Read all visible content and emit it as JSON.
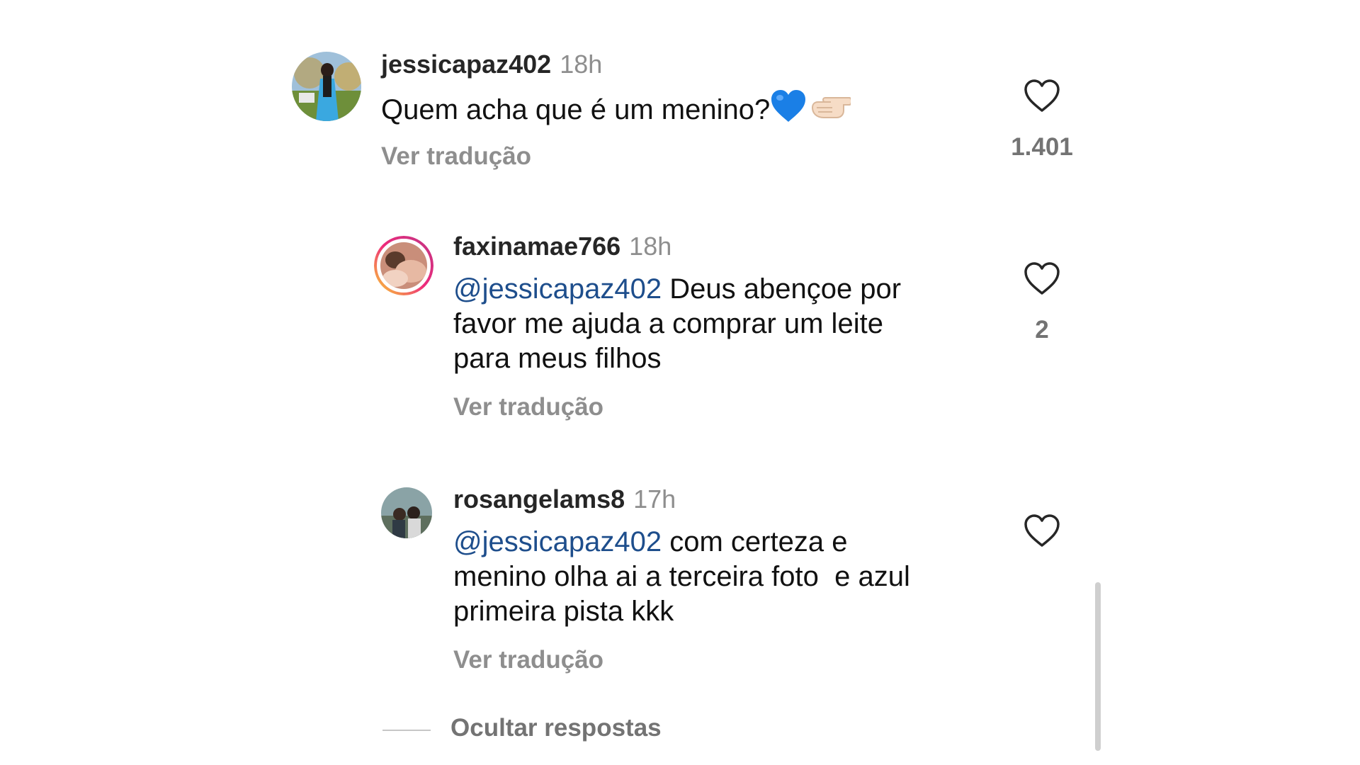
{
  "comments": [
    {
      "username": "jessicapaz402",
      "time": "18h",
      "text": "Quem acha que é um menino?",
      "emoji": [
        "blue-heart",
        "left-pointing-hand"
      ],
      "translate_label": "Ver tradução",
      "like_count": "1.401"
    }
  ],
  "replies": [
    {
      "username": "faxinamae766",
      "time": "18h",
      "mention": "@jessicapaz402",
      "text_line1": " Deus abençoe por",
      "text_line2": "favor me ajuda a comprar um leite",
      "text_line3": "para meus filhos",
      "translate_label": "Ver tradução",
      "like_count": "2",
      "has_story_ring": true
    },
    {
      "username": "rosangelams8",
      "time": "17h",
      "mention": "@jessicapaz402",
      "text_line1": " com certeza e",
      "text_line2": "menino olha ai a terceira foto  e azul",
      "text_line3": "primeira pista kkk",
      "translate_label": "Ver tradução",
      "like_count": ""
    }
  ],
  "hide_replies_label": "Ocultar respostas",
  "colors": {
    "mention": "#1e4e8c",
    "muted": "#8e8e8e",
    "story_ring_start": "#f9ce34",
    "story_ring_end": "#ee2a7b"
  },
  "icons": {
    "like": "heart-outline-icon"
  }
}
